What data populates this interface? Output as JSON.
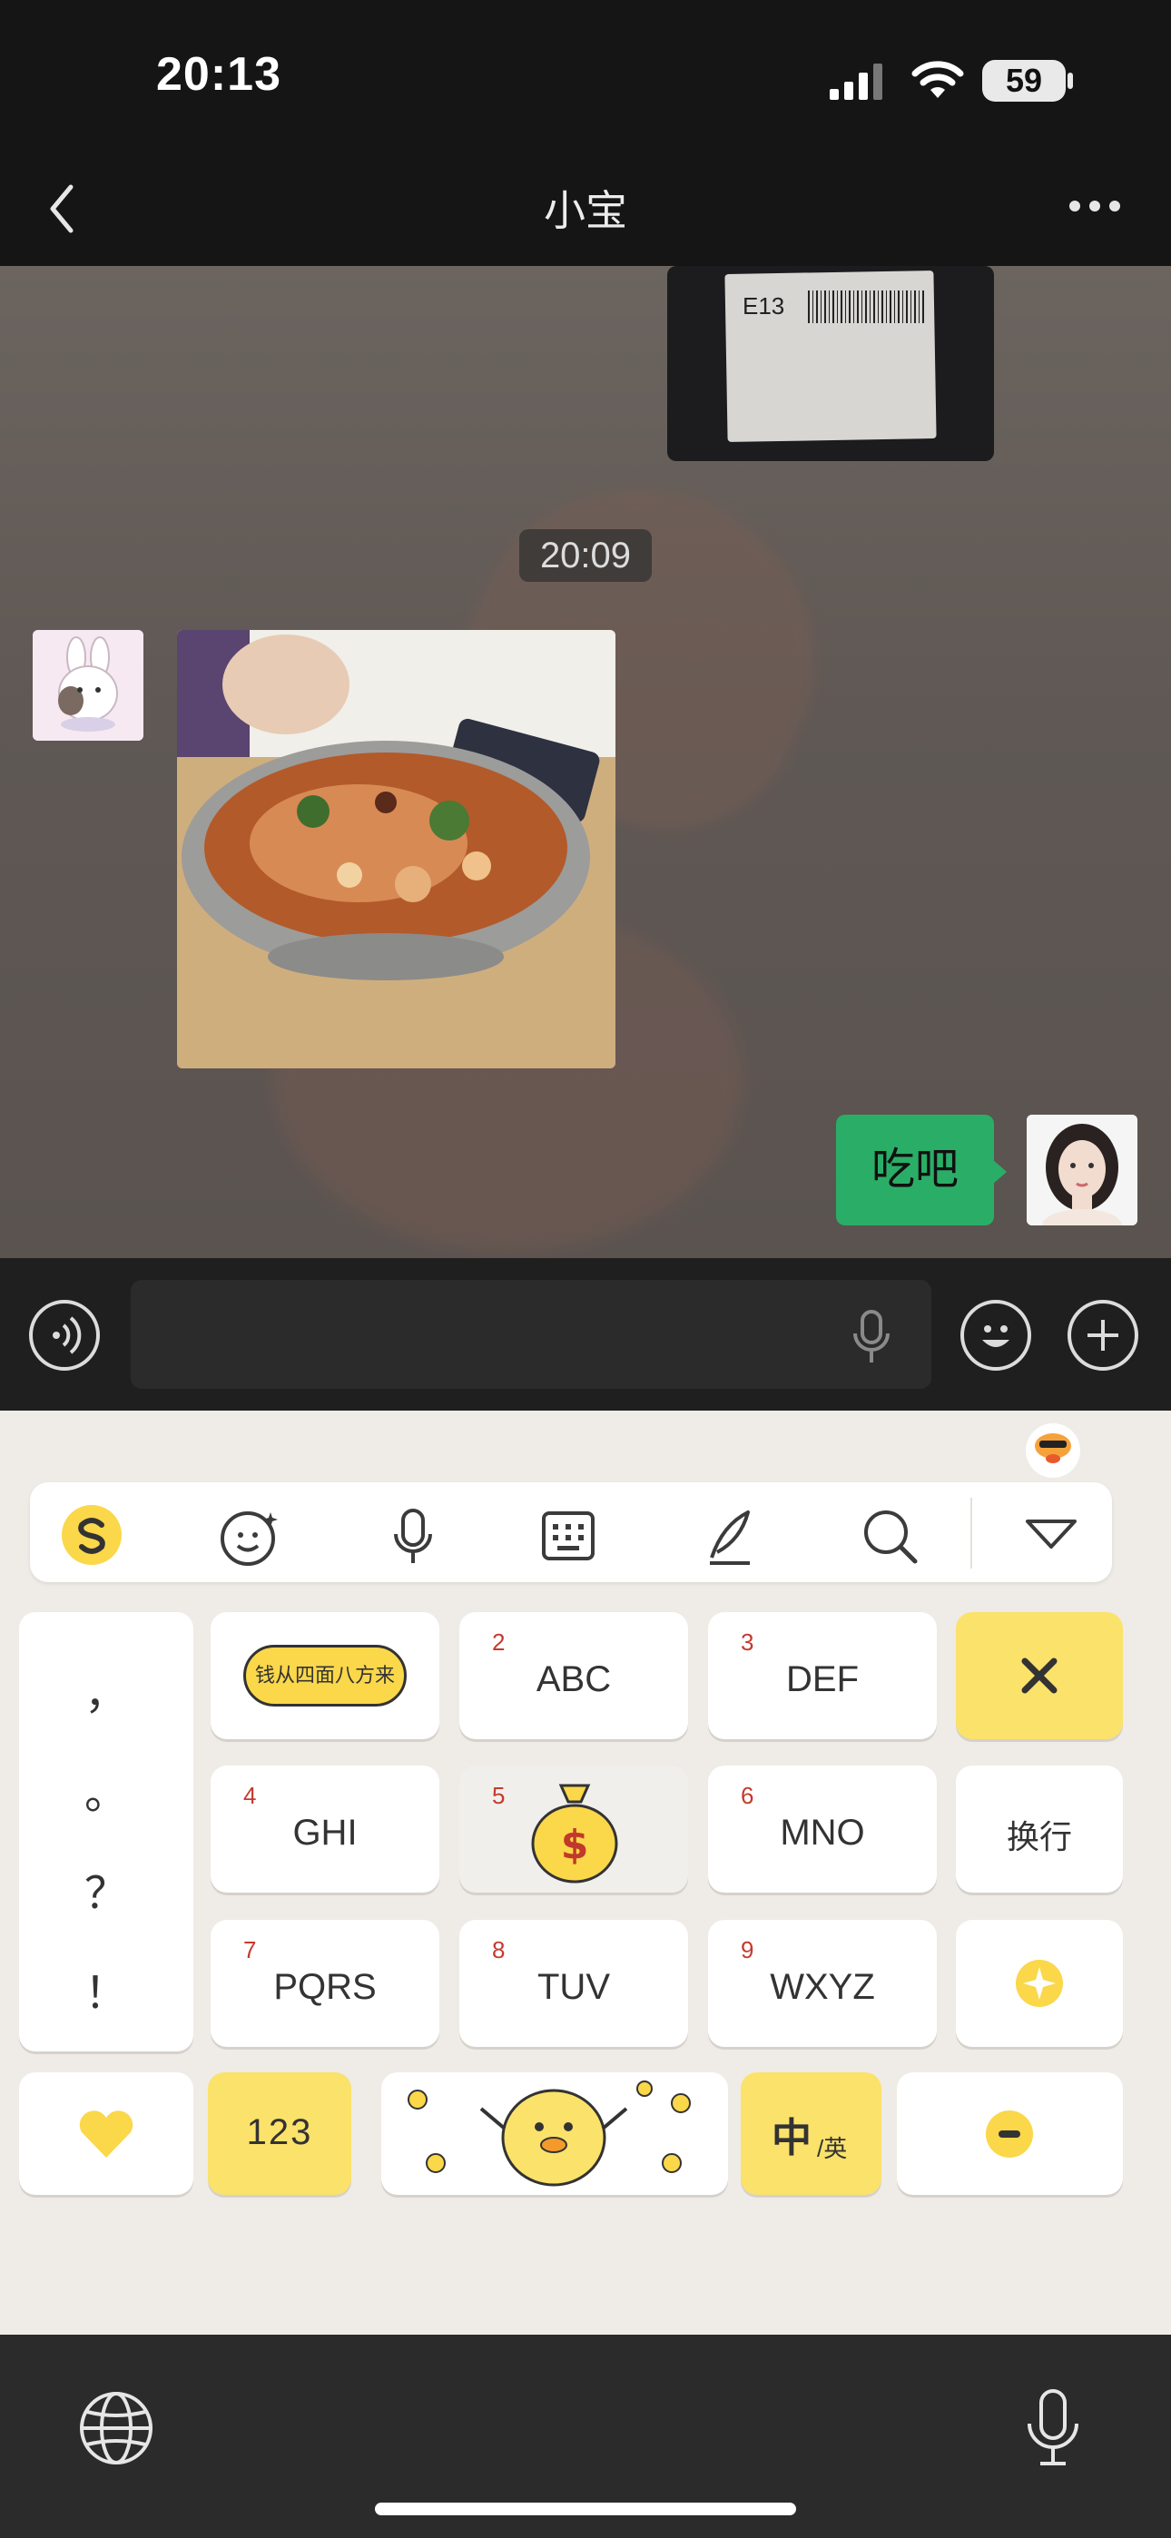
{
  "status_bar": {
    "time": "20:13",
    "battery": "59"
  },
  "nav": {
    "title": "小宝"
  },
  "chat": {
    "package_label_code": "E13",
    "timestamp": "20:09",
    "my_message": "吃吧"
  },
  "keyboard": {
    "toolbar": [
      "logo-icon",
      "emoji-icon",
      "voice-icon",
      "keyboard-icon",
      "handwriting-icon",
      "search-icon",
      "collapse-icon"
    ],
    "punct": [
      "，",
      "。",
      "？",
      "！"
    ],
    "sticker_text": "钱从四面八方来",
    "keys": [
      {
        "num": "2",
        "label": "ABC"
      },
      {
        "num": "3",
        "label": "DEF"
      },
      {
        "num": "4",
        "label": "GHI"
      },
      {
        "num": "5",
        "label": ""
      },
      {
        "num": "6",
        "label": "MNO"
      },
      {
        "num": "7",
        "label": "PQRS"
      },
      {
        "num": "8",
        "label": "TUV"
      },
      {
        "num": "9",
        "label": "WXYZ"
      }
    ],
    "newline": "换行",
    "num_mode": "123",
    "lang_main": "中",
    "lang_sub": "/英"
  },
  "colors": {
    "bubble": "#2aae67",
    "accent_yellow": "#fbe26a",
    "keyboard_bg": "#efebe6"
  }
}
